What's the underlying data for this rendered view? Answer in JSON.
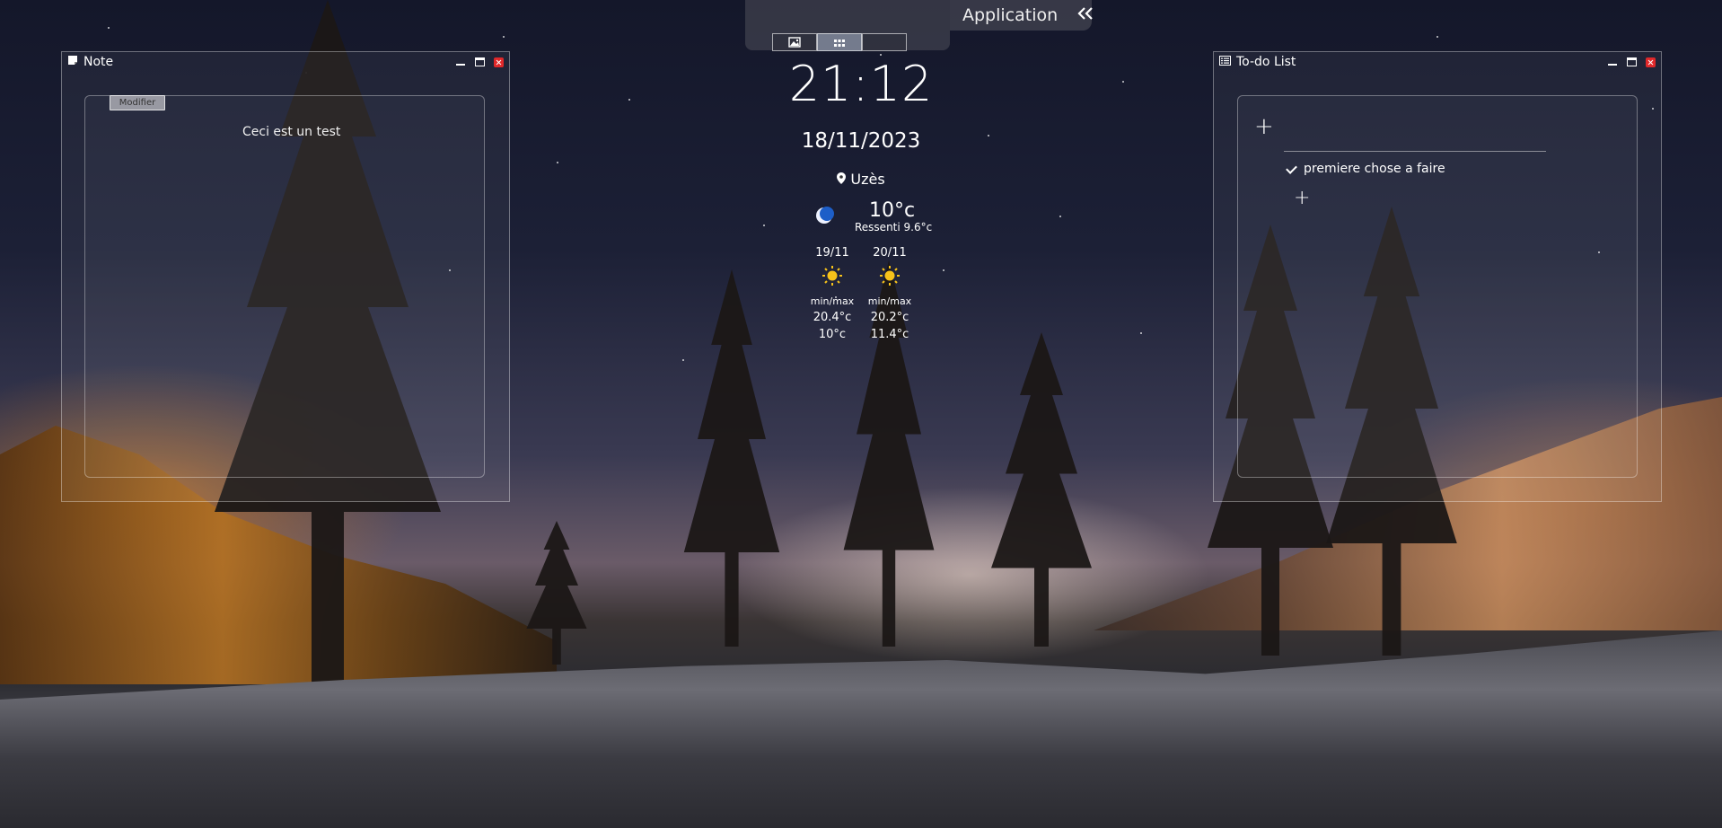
{
  "topbar": {
    "views": [
      {
        "icon": "image-icon",
        "active": false
      },
      {
        "icon": "grid-icon",
        "active": true
      },
      {
        "icon": "blank",
        "active": false
      }
    ],
    "app_label": "Application",
    "collapse_icon": "double-chevron-left-icon"
  },
  "note": {
    "title": "Note",
    "modify_label": "Modifier",
    "text": "Ceci est un test"
  },
  "todo": {
    "title": "To-do List",
    "items": [
      {
        "label": "premiere chose a faire",
        "done": true
      }
    ]
  },
  "clock": {
    "time": "21:12",
    "date": "18/11/2023"
  },
  "weather": {
    "location": "Uzès",
    "current_icon": "moon-icon",
    "temperature": "10°c",
    "feels_like": "Ressenti 9.6°c",
    "forecast": [
      {
        "date": "19/11",
        "icon": "sun-icon",
        "minmax_label": "min/max",
        "max": "20.4°c",
        "min": "10°c"
      },
      {
        "date": "20/11",
        "icon": "sun-icon",
        "minmax_label": "min/max",
        "max": "20.2°c",
        "min": "11.4°c"
      }
    ]
  },
  "colors": {
    "close_button": "#e0282a",
    "active_view": "#aab4c8"
  }
}
